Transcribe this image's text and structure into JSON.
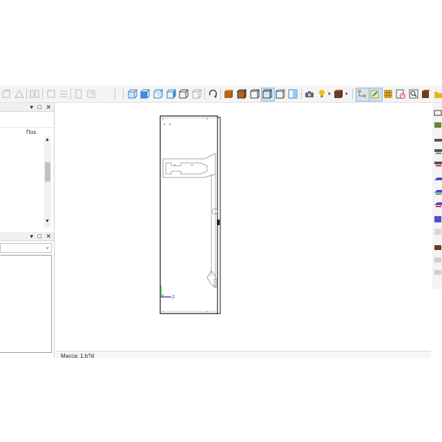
{
  "left_panel_top": {
    "column_header": "Поз."
  },
  "left_panel_bottom": {
    "dropdown_value": ""
  },
  "status_bar": {
    "text": "Масса: 1.b?d"
  },
  "axis": {
    "z_label": "z"
  },
  "colors": {
    "accent_blue": "#2d7bd6",
    "orange_brown": "#b5651d",
    "selected_bg": "#cde6f7"
  }
}
